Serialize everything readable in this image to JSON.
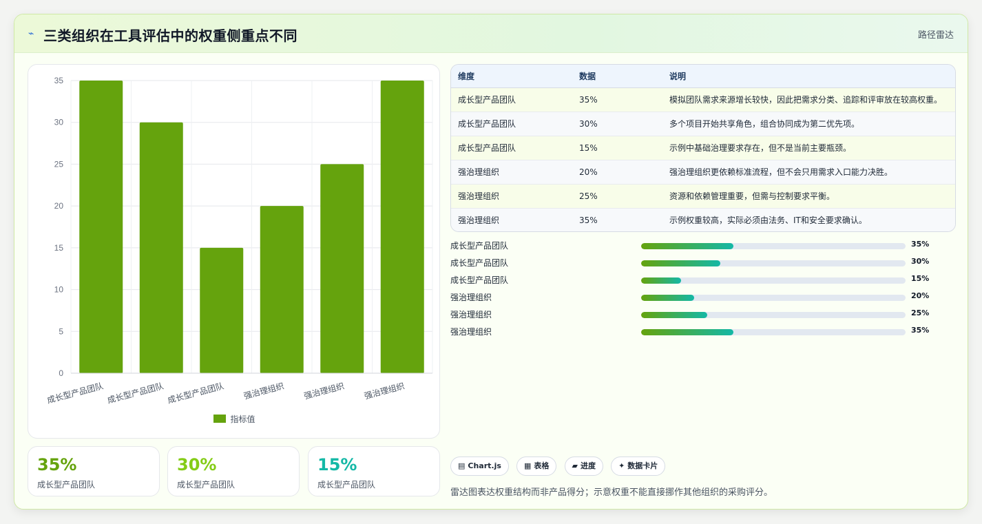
{
  "header": {
    "title": "三类组织在工具评估中的权重侧重点不同",
    "tag": "路径雷达"
  },
  "chart_data": {
    "type": "bar",
    "categories": [
      "成长型产品团队",
      "成长型产品团队",
      "成长型产品团队",
      "强治理组织",
      "强治理组织",
      "强治理组织"
    ],
    "series": [
      {
        "name": "指标值",
        "values": [
          35,
          30,
          15,
          20,
          25,
          35
        ]
      }
    ],
    "ylim": [
      0,
      35
    ],
    "yticks": [
      0,
      5,
      10,
      15,
      20,
      25,
      30,
      35
    ],
    "grid": true,
    "legend_position": "bottom",
    "bar_color": "#65a30d"
  },
  "stats": [
    {
      "value": "35%",
      "label": "成长型产品团队",
      "color": "#65a30d"
    },
    {
      "value": "30%",
      "label": "成长型产品团队",
      "color": "#84cc16"
    },
    {
      "value": "15%",
      "label": "成长型产品团队",
      "color": "#14b8a6"
    }
  ],
  "table": {
    "headers": [
      "维度",
      "数据",
      "说明"
    ],
    "rows": [
      [
        "成长型产品团队",
        "35%",
        "模拟团队需求来源增长较快，因此把需求分类、追踪和评审放在较高权重。"
      ],
      [
        "成长型产品团队",
        "30%",
        "多个项目开始共享角色，组合协同成为第二优先项。"
      ],
      [
        "成长型产品团队",
        "15%",
        "示例中基础治理要求存在，但不是当前主要瓶颈。"
      ],
      [
        "强治理组织",
        "20%",
        "强治理组织更依赖标准流程，但不会只用需求入口能力决胜。"
      ],
      [
        "强治理组织",
        "25%",
        "资源和依赖管理重要，但需与控制要求平衡。"
      ],
      [
        "强治理组织",
        "35%",
        "示例权重较高，实际必须由法务、IT和安全要求确认。"
      ]
    ]
  },
  "progress": [
    {
      "label": "成长型产品团队",
      "value": 35,
      "text": "35%"
    },
    {
      "label": "成长型产品团队",
      "value": 30,
      "text": "30%"
    },
    {
      "label": "成长型产品团队",
      "value": 15,
      "text": "15%"
    },
    {
      "label": "强治理组织",
      "value": 20,
      "text": "20%"
    },
    {
      "label": "强治理组织",
      "value": 25,
      "text": "25%"
    },
    {
      "label": "强治理组织",
      "value": 35,
      "text": "35%"
    }
  ],
  "pills": [
    {
      "icon": "▤",
      "label": "Chart.js"
    },
    {
      "icon": "▦",
      "label": "表格"
    },
    {
      "icon": "▰",
      "label": "进度"
    },
    {
      "icon": "✦",
      "label": "数据卡片"
    }
  ],
  "note": "雷达图表达权重结构而非产品得分；示意权重不能直接挪作其他组织的采购评分。"
}
